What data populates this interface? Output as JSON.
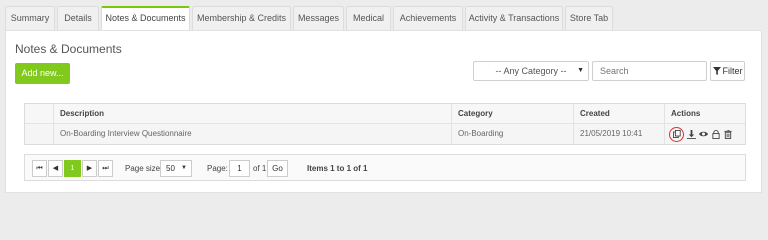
{
  "tabs": [
    {
      "label": "Summary",
      "active": false
    },
    {
      "label": "Details",
      "active": false
    },
    {
      "label": "Notes & Documents",
      "active": true
    },
    {
      "label": "Membership & Credits",
      "active": false
    },
    {
      "label": "Messages",
      "active": false
    },
    {
      "label": "Medical",
      "active": false
    },
    {
      "label": "Achievements",
      "active": false
    },
    {
      "label": "Activity & Transactions",
      "active": false
    },
    {
      "label": "Store Tab",
      "active": false
    }
  ],
  "panel": {
    "title": "Notes & Documents",
    "add_button": "Add new...",
    "category_select": "-- Any Category --",
    "search_placeholder": "Search",
    "filter_button": "Filter"
  },
  "table": {
    "columns": [
      "Description",
      "Category",
      "Created",
      "Actions"
    ],
    "rows": [
      {
        "description": "On-Boarding Interview Questionnaire",
        "category": "On-Boarding",
        "created": "21/05/2019 10:41",
        "actions": [
          "copy-icon",
          "download-icon",
          "view-icon",
          "lock-icon",
          "delete-icon"
        ]
      }
    ]
  },
  "pager": {
    "first": "⏮",
    "prev": "◀",
    "current_page": "1",
    "next": "▶",
    "last": "⏭",
    "page_size_label": "Page size:",
    "page_size": "50",
    "page_label": "Page:",
    "page_value": "1",
    "of_label": "of 1",
    "go_button": "Go",
    "items_info": "Items 1 to 1 of 1"
  },
  "colors": {
    "accent": "#82c91e",
    "highlight_ring": "#d63031"
  }
}
